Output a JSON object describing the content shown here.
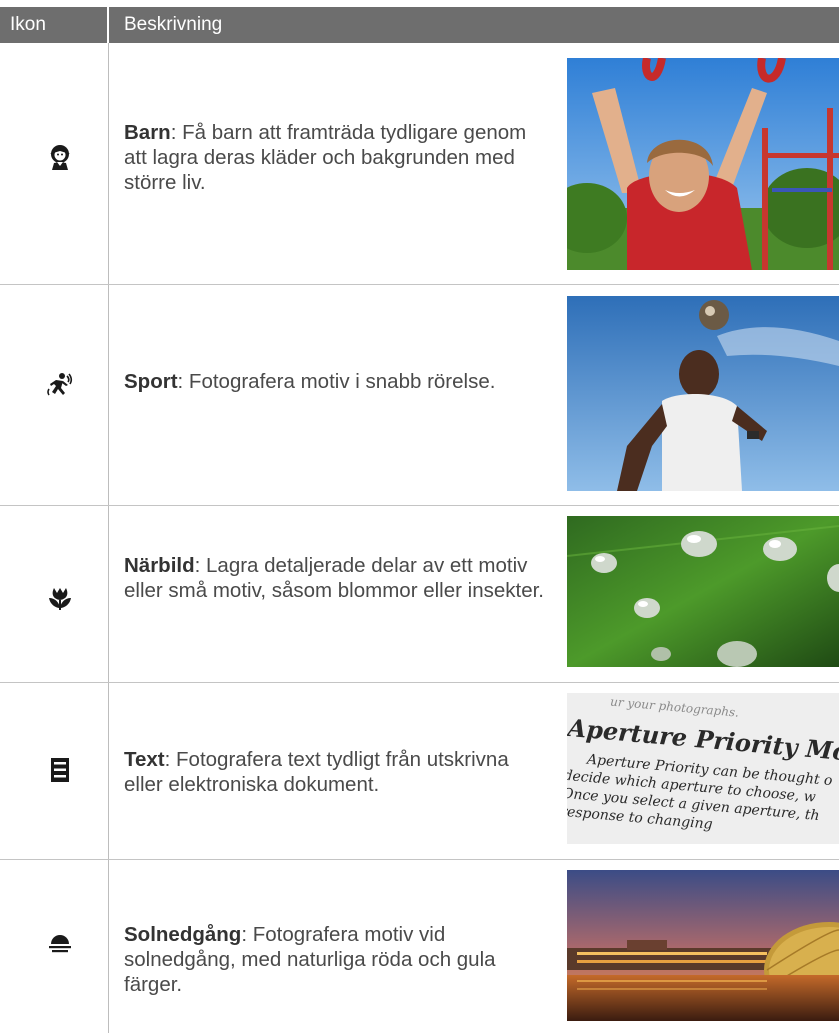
{
  "table": {
    "headers": {
      "icon": "Ikon",
      "description": "Beskrivning"
    },
    "rows": [
      {
        "icon": "child-icon",
        "title": "Barn",
        "text": ": Få barn att framträda tydligare genom att lagra deras kläder och bakgrunden med större liv."
      },
      {
        "icon": "sport-icon",
        "title": "Sport",
        "text": ": Fotografera motiv i snabb rörelse."
      },
      {
        "icon": "macro-flower-icon",
        "title": "Närbild",
        "text": ": Lagra detaljerade delar av ett motiv eller små motiv, såsom blommor eller insekter."
      },
      {
        "icon": "text-document-icon",
        "title": "Text",
        "text": ": Fotografera text tydligt från utskrivna eller elektroniska dokument."
      },
      {
        "icon": "sunset-icon",
        "title": "Solnedgång",
        "text": ": Fotografera motiv vid solnedgång, med naturliga röda och gula färger."
      }
    ],
    "photo_text": {
      "top_line": "ur your photographs.",
      "heading": "Aperture Priority Mode",
      "line1": "Aperture Priority can be thought o",
      "line2": "decide which aperture to choose, w",
      "line3": "Once you select a given aperture, th",
      "line4": "response to changing"
    }
  },
  "colors": {
    "header_bg": "#6e6e6e",
    "header_text": "#ffffff",
    "body_text": "#4a4a4a",
    "rule": "#c4c4c4"
  }
}
